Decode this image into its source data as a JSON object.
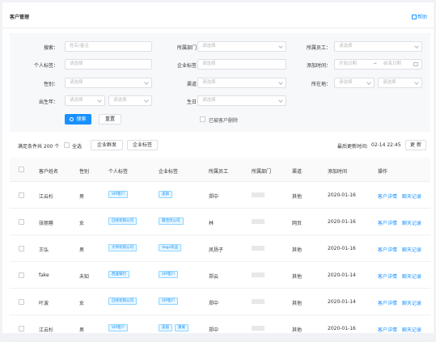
{
  "header": {
    "title": "客户管理",
    "help": "帮助"
  },
  "filters": {
    "search_label": "搜索：",
    "search_placeholder": "姓名/备注",
    "dept_label": "所属部门：",
    "dept_placeholder": "请选择",
    "staff_label": "所属员工：",
    "staff_placeholder": "请选择",
    "personal_tag_label": "个人标签：",
    "personal_tag_placeholder": "请选择",
    "company_tag_label": "企业标签：",
    "company_tag_placeholder": "请选择",
    "add_time_label": "添加时间：",
    "start_date": "开始日期",
    "end_date": "结束日期",
    "gender_label": "性别：",
    "gender_placeholder": "请选择",
    "channel_label": "渠道：",
    "channel_placeholder": "请选择",
    "location_label": "所在地：",
    "location_province": "请选择",
    "location_city": "请选择",
    "birth_year_label": "出生年：",
    "birth_year_a": "请选择",
    "birth_year_b": "请选择",
    "birthday_label": "生日：",
    "birthday_placeholder": "请选择",
    "search_button": "搜索",
    "reset_button": "重置",
    "deleted_checkbox": "已被客户删除"
  },
  "toolbar": {
    "count_text": "满足条件共 200 个",
    "select_all": "全选",
    "company_group": "企业群发",
    "company_tag": "企业标签",
    "update_time_label": "最后更新时间:",
    "update_time": "02-14 22:45",
    "refresh": "更 新"
  },
  "table": {
    "columns": [
      "客户姓名",
      "性别",
      "个人标签",
      "企业标签",
      "所属员工",
      "所属部门",
      "渠道",
      "添加时间",
      "操作"
    ],
    "rows": [
      {
        "name": "江云杉",
        "gender": "男",
        "personal_tags": [
          "VIP客户"
        ],
        "company_tags": [
          "美丽"
        ],
        "staff": "郑中",
        "channel": "其他",
        "date": "2020-01-16",
        "action1": "客户详情",
        "action2": "聊天记录"
      },
      {
        "name": "张丽蓉",
        "gender": "女",
        "personal_tags": [
          "已找有限公司"
        ],
        "company_tags": [
          "最佳优公司"
        ],
        "staff": "林",
        "channel": "网页",
        "date": "2020-01-16",
        "action1": "客户详情",
        "action2": "聊天记录"
      },
      {
        "name": "王弘",
        "gender": "男",
        "personal_tags": [
          "大师有限公司"
        ],
        "company_tags": [
          "Vega有品"
        ],
        "staff": "凤扬子",
        "channel": "其他",
        "date": "2020-01-16",
        "action1": "客户详情",
        "action2": "聊天记录"
      },
      {
        "name": "fake",
        "gender": "未知",
        "personal_tags": [
          "西盛银行"
        ],
        "company_tags": [
          "VIP客户"
        ],
        "staff": "郑云",
        "channel": "其他",
        "date": "2020-01-14",
        "action1": "客户详情",
        "action2": "聊天记录"
      },
      {
        "name": "叶波",
        "gender": "女",
        "personal_tags": [
          "已找有限公司"
        ],
        "company_tags": [
          "VIP客户"
        ],
        "staff": "郑中",
        "channel": "其他",
        "date": "2020-01-14",
        "action1": "客户详情",
        "action2": "聊天记录"
      },
      {
        "name": "江云杉",
        "gender": "男",
        "personal_tags": [
          "VIP客户"
        ],
        "company_tags": [
          "美丽",
          "重要"
        ],
        "staff": "郑中",
        "channel": "其他",
        "date": "2020-01-16",
        "action1": "客户详情",
        "action2": "聊天记录"
      }
    ]
  }
}
